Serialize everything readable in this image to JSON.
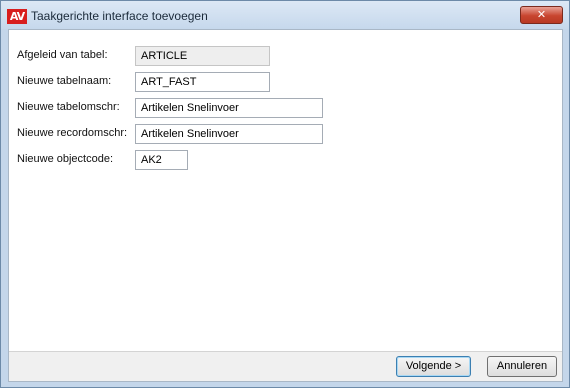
{
  "window": {
    "title": "Taakgerichte interface toevoegen",
    "icon_text": "AV",
    "close_glyph": "✕"
  },
  "form": {
    "rows": [
      {
        "label": "Afgeleid van tabel:",
        "value": "ARTICLE",
        "readonly": true
      },
      {
        "label": "Nieuwe tabelnaam:",
        "value": "ART_FAST",
        "readonly": false
      },
      {
        "label": "Nieuwe tabelomschr:",
        "value": "Artikelen Snelinvoer",
        "readonly": false
      },
      {
        "label": "Nieuwe recordomschr:",
        "value": "Artikelen Snelinvoer",
        "readonly": false
      },
      {
        "label": "Nieuwe objectcode:",
        "value": "AK2",
        "readonly": false
      }
    ]
  },
  "buttons": {
    "next_label": "Volgende >",
    "cancel_label": "Annuleren"
  },
  "colors": {
    "icon_red": "#d81e1e",
    "close_red": "#c8452f",
    "frame_blue": "#c4d6ea"
  }
}
